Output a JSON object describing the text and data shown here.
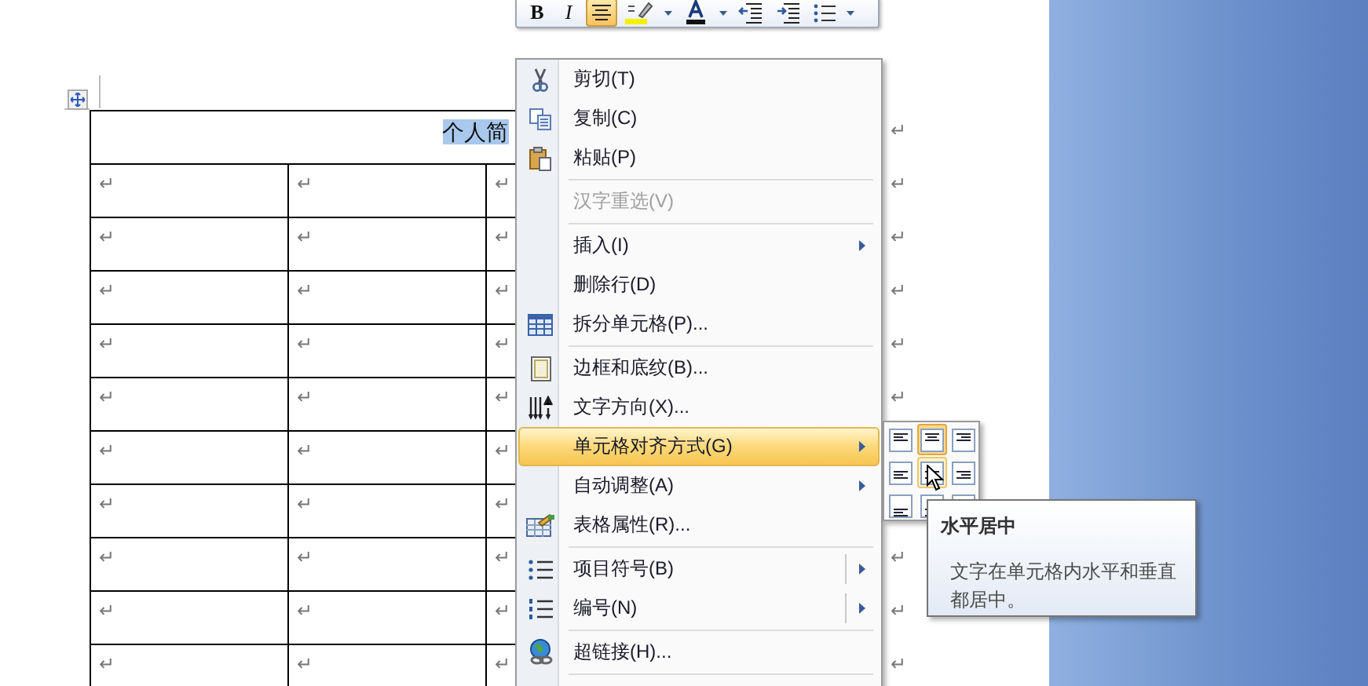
{
  "toolbar": [
    {
      "kind": "bold",
      "label": "B",
      "selected": false
    },
    {
      "kind": "italic",
      "label": "I",
      "selected": false
    },
    {
      "kind": "align",
      "selected": true
    },
    {
      "kind": "highlight",
      "selected": false
    },
    {
      "kind": "dropdown",
      "selected": false
    },
    {
      "kind": "font-color",
      "selected": false
    },
    {
      "kind": "dropdown",
      "selected": false
    },
    {
      "kind": "outdent",
      "selected": false
    },
    {
      "kind": "indent",
      "selected": false
    },
    {
      "kind": "bullets",
      "selected": false
    },
    {
      "kind": "dropdown",
      "selected": false
    }
  ],
  "table": {
    "title": "个人简",
    "title_row_end": "↵",
    "rows": [
      {
        "column_1": "↵",
        "column_2": "↵",
        "column_3": "↵",
        "row_end": "↵"
      },
      {
        "column_1": "↵",
        "column_2": "↵",
        "column_3": "↵",
        "row_end": "↵"
      },
      {
        "column_1": "↵",
        "column_2": "↵",
        "column_3": "↵",
        "row_end": "↵"
      },
      {
        "column_1": "↵",
        "column_2": "↵",
        "column_3": "↵",
        "row_end": "↵"
      },
      {
        "column_1": "↵",
        "column_2": "↵",
        "column_3": "↵",
        "row_end": "↵"
      },
      {
        "column_1": "↵",
        "column_2": "↵",
        "column_3": "↵"
      },
      {
        "column_1": "↵",
        "column_2": "↵",
        "column_3": "↵"
      },
      {
        "column_1": "↵",
        "column_2": "↵",
        "column_3": "↵",
        "row_end": "↵"
      },
      {
        "column_1": "↵",
        "column_2": "↵",
        "column_3": "↵",
        "row_end": "↵"
      },
      {
        "column_1": "↵",
        "column_2": "↵",
        "column_3": "↵",
        "row_end": "↵"
      }
    ]
  },
  "context_menu": [
    {
      "kind": "item",
      "label": "剪切(T)",
      "disabled": false,
      "selected": false
    },
    {
      "kind": "item",
      "label": "复制(C)",
      "disabled": false,
      "selected": false
    },
    {
      "kind": "item",
      "label": "粘贴(P)",
      "disabled": false,
      "selected": false
    },
    {
      "kind": "separator"
    },
    {
      "kind": "item",
      "label": "汉字重选(V)",
      "disabled": true,
      "selected": false
    },
    {
      "kind": "separator"
    },
    {
      "kind": "submenu",
      "label": "插入(I)",
      "disabled": false,
      "selected": false
    },
    {
      "kind": "item",
      "label": "删除行(D)",
      "disabled": false,
      "selected": false
    },
    {
      "kind": "item",
      "label": "拆分单元格(P)...",
      "disabled": false,
      "selected": false
    },
    {
      "kind": "separator"
    },
    {
      "kind": "item",
      "label": "边框和底纹(B)...",
      "disabled": false,
      "selected": false
    },
    {
      "kind": "item",
      "label": "文字方向(X)...",
      "disabled": false,
      "selected": false
    },
    {
      "kind": "submenu",
      "label": "单元格对齐方式(G)",
      "disabled": false,
      "selected": true
    },
    {
      "kind": "submenu",
      "label": "自动调整(A)",
      "disabled": false,
      "selected": false
    },
    {
      "kind": "item",
      "label": "表格属性(R)...",
      "disabled": false,
      "selected": false
    },
    {
      "kind": "separator"
    },
    {
      "kind": "split",
      "label": "项目符号(B)",
      "disabled": false,
      "selected": false
    },
    {
      "kind": "split",
      "label": "编号(N)",
      "disabled": false,
      "selected": false
    },
    {
      "kind": "separator"
    },
    {
      "kind": "item",
      "label": "超链接(H)...",
      "disabled": false,
      "selected": false
    },
    {
      "kind": "separator"
    }
  ],
  "align_options": [
    {
      "selected": false,
      "hovered": false
    },
    {
      "selected": true,
      "hovered": false
    },
    {
      "selected": false,
      "hovered": false
    },
    {
      "selected": false,
      "hovered": false
    },
    {
      "selected": false,
      "hovered": true
    },
    {
      "selected": false,
      "hovered": false
    },
    {
      "selected": false,
      "hovered": false
    },
    {
      "selected": false,
      "hovered": false
    },
    {
      "selected": false,
      "hovered": false
    }
  ],
  "tooltip": {
    "title": "水平居中",
    "description": "文字在单元格内水平和垂直都居中。"
  }
}
